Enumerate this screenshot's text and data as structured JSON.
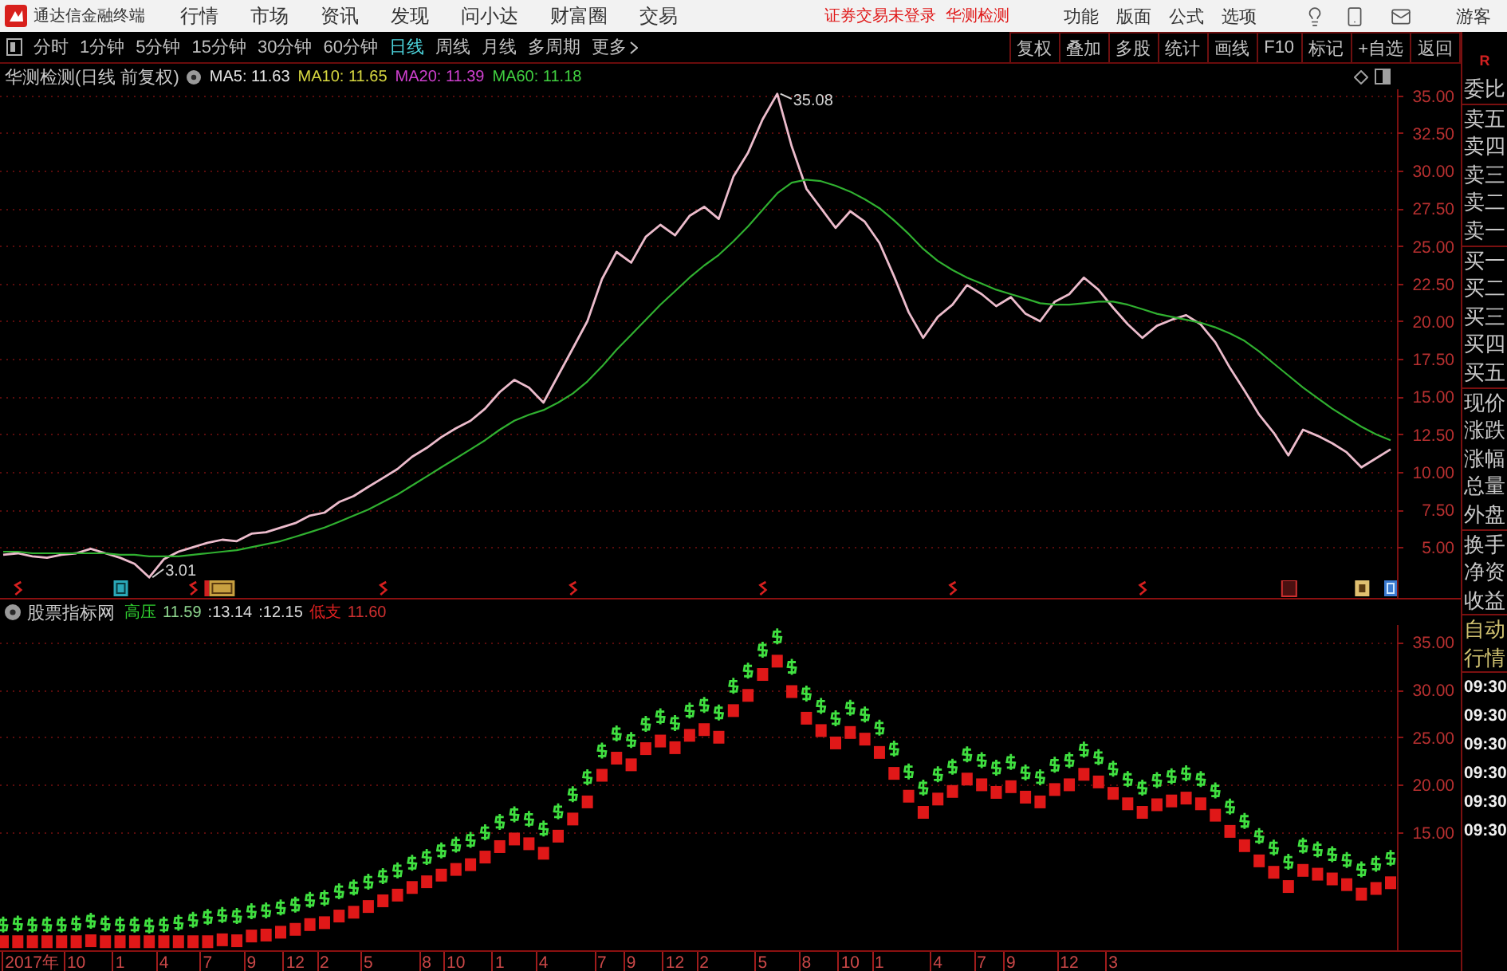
{
  "window": {
    "title": "通达信金融终端"
  },
  "menu": [
    "行情",
    "市场",
    "资讯",
    "发现",
    "问小达",
    "财富圈",
    "交易"
  ],
  "notices": [
    "证券交易未登录",
    "华测检测"
  ],
  "top_actions": [
    "功能",
    "版面",
    "公式",
    "选项"
  ],
  "user": "游客",
  "periods": [
    {
      "label": "分时",
      "selected": false
    },
    {
      "label": "1分钟",
      "selected": false
    },
    {
      "label": "5分钟",
      "selected": false
    },
    {
      "label": "15分钟",
      "selected": false
    },
    {
      "label": "30分钟",
      "selected": false
    },
    {
      "label": "60分钟",
      "selected": false
    },
    {
      "label": "日线",
      "selected": true
    },
    {
      "label": "周线",
      "selected": false
    },
    {
      "label": "月线",
      "selected": false
    },
    {
      "label": "多周期",
      "selected": false
    }
  ],
  "more": "更多",
  "chart_tools": [
    "复权",
    "叠加",
    "多股",
    "统计",
    "画线",
    "F10",
    "标记",
    "+自选",
    "返回"
  ],
  "price_panel": {
    "title": "华测检测(日线 前复权)",
    "indicators": [
      {
        "label": "MA5: 11.63",
        "color": "#e4e4e4"
      },
      {
        "label": "MA10: 11.65",
        "color": "#d8d840"
      },
      {
        "label": "MA20: 11.39",
        "color": "#d040d0"
      },
      {
        "label": "MA60: 11.18",
        "color": "#40d040"
      }
    ],
    "chart_data": {
      "type": "line",
      "grid": true,
      "ylim": [
        2.8,
        35.4
      ],
      "yticks": [
        {
          "value": 35,
          "label": "35.00"
        },
        {
          "value": 32.5,
          "label": "32.50"
        },
        {
          "value": 30,
          "label": "30.00"
        },
        {
          "value": 27.5,
          "label": "27.50"
        },
        {
          "value": 25,
          "label": "25.00"
        },
        {
          "value": 22.5,
          "label": "22.50"
        },
        {
          "value": 20,
          "label": "20.00"
        },
        {
          "value": 17.5,
          "label": "17.50"
        },
        {
          "value": 15,
          "label": "15.00"
        },
        {
          "value": 12.5,
          "label": "12.50"
        },
        {
          "value": 10,
          "label": "10.00"
        },
        {
          "value": 7.5,
          "label": "7.50"
        },
        {
          "value": 5,
          "label": "5.00"
        }
      ],
      "series": [
        {
          "color": "#ecbccc",
          "values": [
            4.5,
            4.6,
            4.4,
            4.3,
            4.5,
            4.6,
            4.9,
            4.6,
            4.3,
            3.9,
            3.0,
            4.2,
            4.7,
            5.0,
            5.3,
            5.5,
            5.4,
            5.9,
            6.0,
            6.3,
            6.6,
            7.1,
            7.3,
            8.0,
            8.4,
            9.0,
            9.6,
            10.2,
            11.0,
            11.6,
            12.3,
            12.9,
            13.4,
            14.2,
            15.3,
            16.1,
            15.6,
            14.6,
            16.4,
            18.2,
            20.0,
            22.8,
            24.6,
            23.9,
            25.6,
            26.4,
            25.7,
            27.0,
            27.6,
            26.8,
            29.6,
            31.2,
            33.4,
            35.1,
            31.6,
            28.8,
            27.5,
            26.2,
            27.3,
            26.6,
            25.2,
            23.0,
            20.6,
            18.9,
            20.3,
            21.1,
            22.4,
            21.8,
            21.0,
            21.6,
            20.5,
            20.0,
            21.3,
            21.8,
            22.9,
            22.1,
            20.9,
            19.8,
            18.9,
            19.7,
            20.1,
            20.4,
            19.8,
            18.6,
            16.9,
            15.4,
            13.8,
            12.6,
            11.1,
            12.8,
            12.4,
            11.9,
            11.3,
            10.3,
            10.9,
            11.5
          ]
        },
        {
          "color": "#30b030",
          "values": [
            4.7,
            4.7,
            4.6,
            4.6,
            4.6,
            4.6,
            4.6,
            4.6,
            4.5,
            4.5,
            4.4,
            4.4,
            4.4,
            4.5,
            4.6,
            4.7,
            4.8,
            5.0,
            5.2,
            5.4,
            5.7,
            6.0,
            6.3,
            6.7,
            7.1,
            7.5,
            8.0,
            8.5,
            9.1,
            9.7,
            10.3,
            10.9,
            11.5,
            12.1,
            12.8,
            13.4,
            13.8,
            14.1,
            14.6,
            15.2,
            16.0,
            17.0,
            18.1,
            19.1,
            20.1,
            21.1,
            22.0,
            22.9,
            23.7,
            24.4,
            25.3,
            26.3,
            27.4,
            28.5,
            29.2,
            29.4,
            29.3,
            29.0,
            28.6,
            28.1,
            27.5,
            26.7,
            25.8,
            24.8,
            24.0,
            23.4,
            22.9,
            22.5,
            22.1,
            21.8,
            21.5,
            21.2,
            21.1,
            21.1,
            21.2,
            21.3,
            21.3,
            21.1,
            20.8,
            20.5,
            20.3,
            20.1,
            19.9,
            19.6,
            19.2,
            18.7,
            18.0,
            17.2,
            16.4,
            15.6,
            14.9,
            14.2,
            13.6,
            13.0,
            12.5,
            12.1
          ]
        }
      ],
      "annotations": [
        "35.08",
        "3.01"
      ]
    },
    "events": [
      {
        "kind": "dividend"
      },
      {
        "kind": "unlock"
      },
      {
        "kind": "dividend"
      },
      {
        "kind": "limit"
      },
      {
        "kind": "dividend"
      },
      {
        "kind": "dividend"
      },
      {
        "kind": "dividend"
      },
      {
        "kind": "dividend"
      },
      {
        "kind": "dividend"
      },
      {
        "kind": "notice"
      },
      {
        "kind": "report"
      },
      {
        "kind": "finance"
      }
    ]
  },
  "indicator_panel": {
    "title": "股票指标网",
    "readings": [
      {
        "text": "高压",
        "color": "#30d030"
      },
      {
        "text": "11.59",
        "color": "#90d890"
      },
      {
        "text": ":13.14",
        "color": "#d8d8d8"
      },
      {
        "text": ":12.15",
        "color": "#d8d8d8"
      },
      {
        "text": "低支",
        "color": "#e02020"
      },
      {
        "text": "11.60",
        "color": "#d03030"
      }
    ],
    "chart_data": {
      "type": "scatter",
      "grid": true,
      "ylim": [
        2.6,
        36.8
      ],
      "categories": [
        null,
        null,
        "2017年",
        null,
        null,
        "10",
        null,
        null,
        "1",
        null,
        null,
        "4",
        null,
        null,
        "7",
        null,
        null,
        "9",
        null,
        null,
        "12",
        null,
        "2",
        null,
        null,
        "5",
        null,
        null,
        null,
        "8",
        null,
        "10",
        null,
        null,
        "1",
        null,
        null,
        "4",
        null,
        null,
        null,
        "7",
        null,
        "9",
        null,
        null,
        "12",
        null,
        "2",
        null,
        null,
        null,
        "5",
        null,
        null,
        "8",
        null,
        null,
        "10",
        null,
        "1",
        null,
        null,
        null,
        "4",
        null,
        null,
        "7",
        null,
        "9",
        null,
        null,
        null,
        "12",
        null,
        null,
        "3",
        null,
        null,
        null,
        null,
        null,
        null,
        null,
        null,
        null,
        null,
        null,
        null,
        null,
        null,
        null,
        null,
        null,
        null,
        null
      ],
      "series": [
        {
          "color": "#40e040",
          "values": [
            5.3,
            5.4,
            5.3,
            5.3,
            5.3,
            5.4,
            5.7,
            5.4,
            5.3,
            5.3,
            5.2,
            5.3,
            5.5,
            5.8,
            6.1,
            6.3,
            6.2,
            6.7,
            6.8,
            7.1,
            7.4,
            7.9,
            8.1,
            8.8,
            9.2,
            9.8,
            10.4,
            11.0,
            11.8,
            12.4,
            13.1,
            13.7,
            14.2,
            15.0,
            16.1,
            16.9,
            16.4,
            15.4,
            17.2,
            19.0,
            20.8,
            23.6,
            25.4,
            24.7,
            26.4,
            27.2,
            26.5,
            27.8,
            28.4,
            27.6,
            30.4,
            32.0,
            34.2,
            35.6,
            32.4,
            29.6,
            28.3,
            27.0,
            28.1,
            27.4,
            26.0,
            23.8,
            21.4,
            19.7,
            21.1,
            21.9,
            23.2,
            22.6,
            21.8,
            22.4,
            21.3,
            20.8,
            22.1,
            22.6,
            23.7,
            22.9,
            21.7,
            20.6,
            19.7,
            20.5,
            20.9,
            21.2,
            20.6,
            19.4,
            17.7,
            16.2,
            14.6,
            13.4,
            11.9,
            13.6,
            13.2,
            12.7,
            12.1,
            11.1,
            11.7,
            12.3
          ]
        },
        {
          "color": "#e01818",
          "values": [
            3.5,
            3.5,
            3.5,
            3.5,
            3.5,
            3.5,
            3.6,
            3.5,
            3.5,
            3.5,
            3.5,
            3.5,
            3.5,
            3.5,
            3.5,
            3.7,
            3.6,
            4.1,
            4.2,
            4.5,
            4.8,
            5.3,
            5.5,
            6.2,
            6.6,
            7.2,
            7.8,
            8.4,
            9.2,
            9.8,
            10.5,
            11.1,
            11.6,
            12.4,
            13.5,
            14.3,
            13.8,
            12.8,
            14.6,
            16.4,
            18.2,
            21.0,
            22.8,
            22.1,
            23.8,
            24.6,
            23.9,
            25.2,
            25.8,
            25.0,
            27.8,
            29.4,
            31.6,
            33.0,
            29.8,
            27.0,
            25.7,
            24.4,
            25.5,
            24.8,
            23.4,
            21.2,
            18.8,
            17.1,
            18.5,
            19.3,
            20.6,
            20.0,
            19.2,
            19.8,
            18.7,
            18.2,
            19.5,
            20.0,
            21.1,
            20.3,
            19.1,
            18.0,
            17.1,
            17.9,
            18.3,
            18.6,
            18.0,
            16.8,
            15.1,
            13.6,
            12.0,
            10.8,
            9.3,
            11.0,
            10.6,
            10.1,
            9.5,
            8.5,
            9.1,
            9.7
          ]
        }
      ],
      "yticks": [
        {
          "value": 35,
          "label": "35.00"
        },
        {
          "value": 30,
          "label": "30.00"
        },
        {
          "value": 25,
          "label": "25.00"
        },
        {
          "value": 20,
          "label": "20.00"
        },
        {
          "value": 15,
          "label": "15.00"
        }
      ]
    }
  },
  "quote_panel": {
    "header": "R",
    "groups": [
      [
        "委比"
      ],
      [
        "卖五",
        "卖四",
        "卖三",
        "卖二",
        "卖一"
      ],
      [
        "买一",
        "买二",
        "买三",
        "买四",
        "买五"
      ],
      [
        "现价",
        "涨跌",
        "涨幅",
        "总量",
        "外盘"
      ],
      [
        "换手",
        "净资",
        "收益"
      ]
    ],
    "modes": [
      "自动",
      "行情"
    ],
    "times": [
      "09:30",
      "09:30",
      "09:30",
      "09:30",
      "09:30",
      "09:30"
    ]
  }
}
